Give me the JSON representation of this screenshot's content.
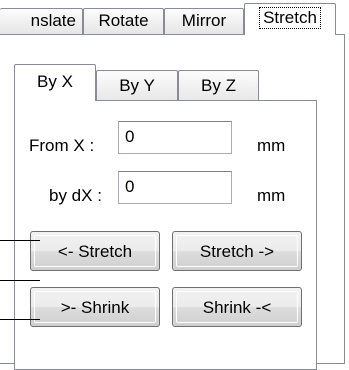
{
  "outer_tabs": [
    {
      "label": "nslate"
    },
    {
      "label": "Rotate"
    },
    {
      "label": "Mirror"
    },
    {
      "label": "Stretch"
    }
  ],
  "inner_tabs": [
    {
      "label": "By X"
    },
    {
      "label": "By Y"
    },
    {
      "label": "By Z"
    }
  ],
  "from_x": {
    "label": "From X :",
    "value": "0",
    "unit": "mm"
  },
  "by_dx": {
    "label": "by dX :",
    "value": "0",
    "unit": "mm"
  },
  "buttons": {
    "stretch_left": "<- Stretch",
    "stretch_right": "Stretch ->",
    "shrink_right": ">- Shrink",
    "shrink_left": "Shrink -<"
  }
}
